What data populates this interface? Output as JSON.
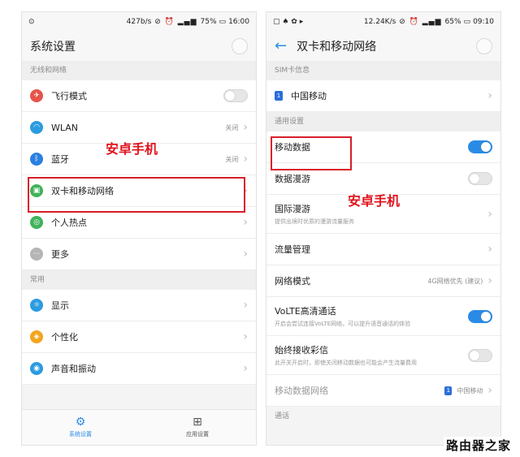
{
  "left": {
    "status": {
      "speed": "427b/s",
      "icons": "⊘ ⏰ ▂▄▆",
      "battery": "75%",
      "time": "16:00"
    },
    "title": "系统设置",
    "section_wireless": "无线和网络",
    "wireless_items": [
      {
        "label": "飞行模式",
        "icon_color": "#e5544a",
        "icon": "✈"
      },
      {
        "label": "WLAN",
        "value": "关闭",
        "icon_color": "#2b9be0",
        "icon": "◠"
      },
      {
        "label": "蓝牙",
        "value": "关闭",
        "icon_color": "#2b7fe0",
        "icon": "ᛒ"
      },
      {
        "label": "双卡和移动网络",
        "icon_color": "#41b25a",
        "icon": "▣"
      },
      {
        "label": "个人热点",
        "icon_color": "#41b25a",
        "icon": "◎"
      },
      {
        "label": "更多",
        "icon_color": "#b5b5b5",
        "icon": "⋯"
      }
    ],
    "section_common": "常用",
    "common_items": [
      {
        "label": "显示",
        "icon_color": "#2b9be0",
        "icon": "☼"
      },
      {
        "label": "个性化",
        "icon_color": "#f2a51e",
        "icon": "◈"
      },
      {
        "label": "声音和振动",
        "icon_color": "#2b9be0",
        "icon": "◉"
      }
    ],
    "nav": [
      {
        "label": "系统设置",
        "active": true
      },
      {
        "label": "应用设置",
        "active": false
      }
    ],
    "overlay": "安卓手机"
  },
  "right": {
    "status": {
      "speed": "12.24K/s",
      "icons": "⊘ ⏰ ▂▄▆",
      "battery": "65%",
      "time": "09:10"
    },
    "title": "双卡和移动网络",
    "section_sim": "SIM卡信息",
    "sim_item": {
      "badge": "1",
      "label": "中国移动"
    },
    "section_general": "通用设置",
    "items": {
      "mobile_data": "移动数据",
      "roaming": "数据漫游",
      "intl_roaming": "国际漫游",
      "intl_roaming_sub": "提供出境时优质的漫游流量服务",
      "traffic": "流量管理",
      "network_mode": "网络模式",
      "network_mode_value": "4G网络优先 (建议)",
      "volte": "VoLTE高清通话",
      "volte_sub": "开启会尝试连接VoLTE网络，可以提升语音通话的体验",
      "mms": "始终接收彩信",
      "mms_sub": "此开关开启时，即使关闭移动数据也可能会产生流量费用",
      "mobile_network": "移动数据网络",
      "mobile_network_value": "中国移动",
      "calls": "通话"
    },
    "overlay": "安卓手机"
  },
  "watermark": "路由器之家"
}
